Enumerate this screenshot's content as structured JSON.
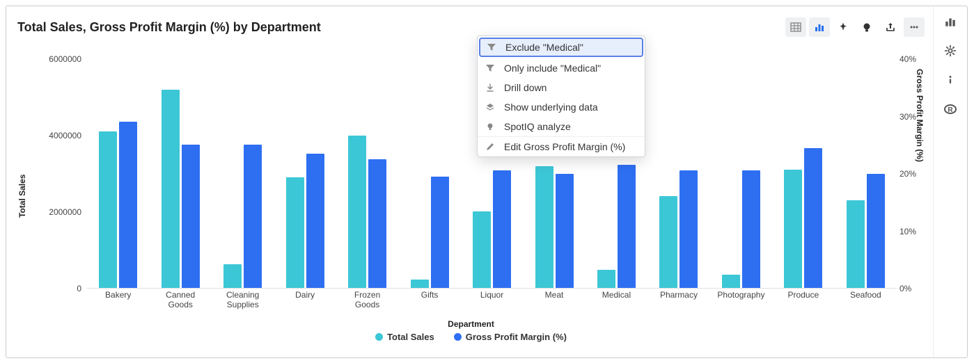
{
  "title": "Total Sales, Gross Profit Margin (%) by Department",
  "toolbar": {
    "table_view": "table-view",
    "chart_view": "chart-view",
    "pin": "pin",
    "spotiq": "spotiq",
    "share": "share",
    "more": "more"
  },
  "side_rail": {
    "chart": "chart-panel",
    "settings": "settings-panel",
    "info": "info-panel",
    "r": "r-panel"
  },
  "legend": {
    "series1": "Total Sales",
    "series2": "Gross Profit Margin (%)"
  },
  "axes": {
    "y_left_label": "Total Sales",
    "y_right_label": "Gross Profit Margin (%)",
    "x_label": "Department",
    "y_left_ticks": [
      "0",
      "2000000",
      "4000000",
      "6000000"
    ],
    "y_right_ticks": [
      "0%",
      "10%",
      "20%",
      "30%",
      "40%"
    ],
    "y_left_max": 6000000,
    "y_right_max": 40
  },
  "context_menu": {
    "items": [
      {
        "label": "Exclude \"Medical\"",
        "icon": "filter"
      },
      {
        "label": "Only include \"Medical\"",
        "icon": "filter"
      },
      {
        "label": "Drill down",
        "icon": "drill"
      },
      {
        "label": "Show underlying data",
        "icon": "layers"
      },
      {
        "label": "SpotIQ analyze",
        "icon": "bulb"
      }
    ],
    "footer": {
      "label": "Edit Gross Profit Margin (%)",
      "icon": "pencil"
    }
  },
  "chart_data": {
    "type": "bar",
    "categories": [
      "Bakery",
      "Canned Goods",
      "Cleaning Supplies",
      "Dairy",
      "Frozen Goods",
      "Gifts",
      "Liquor",
      "Meat",
      "Medical",
      "Pharmacy",
      "Photography",
      "Produce",
      "Seafood"
    ],
    "series": [
      {
        "name": "Total Sales",
        "axis": "left",
        "values": [
          4100000,
          5200000,
          625000,
          2900000,
          4000000,
          225000,
          2000000,
          3200000,
          475000,
          2400000,
          350000,
          3100000,
          2300000
        ]
      },
      {
        "name": "Gross Profit Margin (%)",
        "axis": "right",
        "values": [
          29,
          25,
          25,
          23.5,
          22.5,
          19.5,
          20.5,
          20,
          21.5,
          20.5,
          20.5,
          24.5,
          20
        ]
      }
    ],
    "title": "Total Sales, Gross Profit Margin (%) by Department",
    "xlabel": "Department",
    "y_left": {
      "label": "Total Sales",
      "lim": [
        0,
        6000000
      ]
    },
    "y_right": {
      "label": "Gross Profit Margin (%)",
      "lim": [
        0,
        40
      ],
      "unit": "%"
    },
    "legend_position": "bottom"
  },
  "colors": {
    "series1": "#3cc7d6",
    "series2": "#2e6ff2"
  }
}
